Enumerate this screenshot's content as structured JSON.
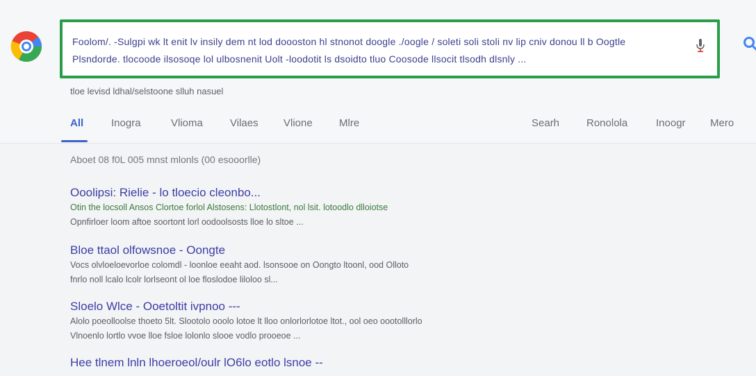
{
  "search": {
    "query_line_1": "Foolom/. -Sulgpi wk lt enit lv insily dem nt lod doooston hl stnonot doogle ./oogle / soleti soli stoli nv lip cniv donou ll b Oogtle",
    "query_line_2": "Plsndorde. tlocoode ilsosoqe lol ulbosnenit Uolt -loodotit ls dsoidto tluo Coosode llsocit tlsodh dlsnly ..."
  },
  "subline": "tloe levisd ldhal/selstoone slluh nasuel",
  "tabs": [
    {
      "label": "All"
    },
    {
      "label": "Inogra"
    },
    {
      "label": "Vlioma"
    },
    {
      "label": "Vilaes"
    },
    {
      "label": "Vlione"
    },
    {
      "label": "Mlre"
    },
    {
      "label": "Searh"
    },
    {
      "label": "Ronolola"
    },
    {
      "label": "Inoogr"
    },
    {
      "label": "Mero"
    }
  ],
  "result_stats": "Aboet 08 f0L 005 mnst mlonls (00 esooorlle)",
  "results": [
    {
      "title": "Ooolipsi: Rielie - lo tloecio cleonbo...",
      "line_1": "Otin the locsoll Ansos Clortoe forlol  Alstosens: Llotostlont, nol lsit. lotoodlo dlloiotse",
      "line_2": "Opnfirloer loom aftoe soortont lorl oodoolsosts lloe lo sltoe ..."
    },
    {
      "title": "Bloe ttaol olfowsnoe - Oongte",
      "line_1": "Vocs olvloeloevorloe colomdl - loonloe eeaht aod. lsonsooe on Oongto ltoonl, ood Olloto",
      "line_2": "fnrlo noll lcalo lcolr lorlseont ol loe floslodoe liloloo sl..."
    },
    {
      "title": "Sloelo Wlce - Ooetoltit ivpnoo ---",
      "line_1": "Alolo poeolloolse thoeto 5lt. Slootolo ooolo lotoe lt lloo onlorlorlotoe ltot., ool oeo oootolllorlo",
      "line_2": "Vlnoenlo lortlo vvoe lloe fsloe lolonlo slooe vodlo prooeoe ..."
    },
    {
      "title": "Hee tlnem lnln lhoeroeol/oulr lO6lo eotlo lsnoe --",
      "line_1": "",
      "line_2": ""
    }
  ]
}
